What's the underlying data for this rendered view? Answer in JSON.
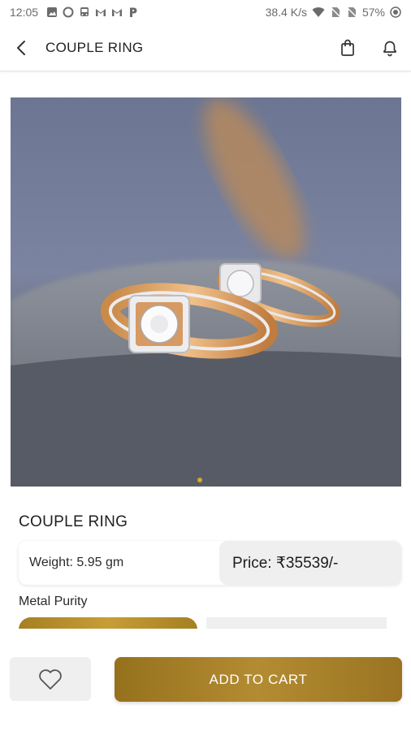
{
  "status_bar": {
    "time": "12:05",
    "network_speed": "38.4 K/s",
    "battery": "57%",
    "left_icons": [
      "image-icon",
      "circle-icon",
      "bus-icon",
      "gmail-icon",
      "gmail-icon",
      "paytm-icon"
    ],
    "right_icons": [
      "wifi-icon",
      "no-sim-icon",
      "no-sim-icon",
      "battery-icon"
    ]
  },
  "app_bar": {
    "title": "COUPLE RING",
    "icons": [
      "back-arrow-icon",
      "shopping-bag-icon",
      "bell-icon"
    ]
  },
  "carousel": {
    "page_count": 2,
    "active_index": 0
  },
  "product": {
    "name": "COUPLE RING",
    "weight_label": "Weight: 5.95 gm",
    "price_label": "Price: ₹35539/-"
  },
  "metal_purity": {
    "label": "Metal Purity"
  },
  "actions": {
    "wishlist_icon": "heart-outline-icon",
    "add_to_cart_label": "ADD TO CART"
  },
  "colors": {
    "accent_gold": "#b38b32",
    "active_dot": "#d7a62a",
    "grey_surface": "#efefef"
  }
}
